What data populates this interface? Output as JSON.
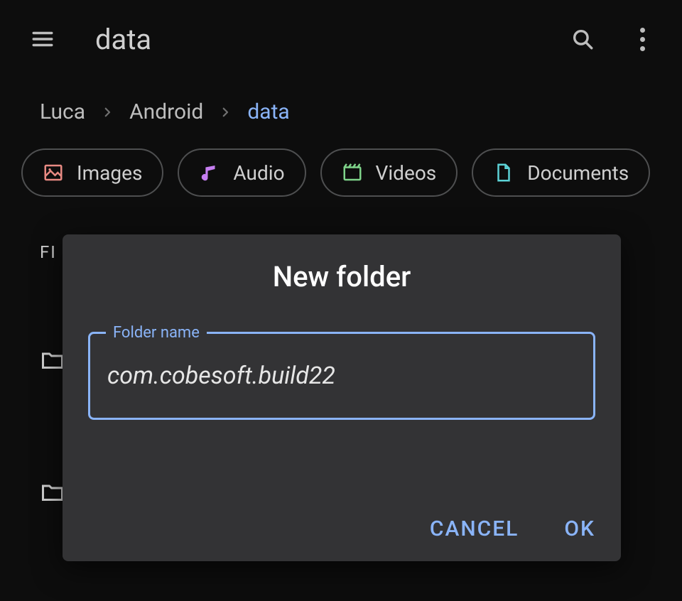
{
  "appbar": {
    "title": "data"
  },
  "breadcrumb": {
    "items": [
      {
        "label": "Luca",
        "active": false
      },
      {
        "label": "Android",
        "active": false
      },
      {
        "label": "data",
        "active": true
      }
    ]
  },
  "chips": [
    {
      "label": "Images",
      "icon": "image-icon",
      "color": "#e88a83"
    },
    {
      "label": "Audio",
      "icon": "audio-icon",
      "color": "#c57ef0"
    },
    {
      "label": "Videos",
      "icon": "video-icon",
      "color": "#7fd38a"
    },
    {
      "label": "Documents",
      "icon": "document-icon",
      "color": "#5cd2d6"
    }
  ],
  "files": {
    "section_label": "FI"
  },
  "dialog": {
    "title": "New folder",
    "field_label": "Folder name",
    "value": "com.cobesoft.build22",
    "cancel_label": "CANCEL",
    "ok_label": "OK"
  }
}
